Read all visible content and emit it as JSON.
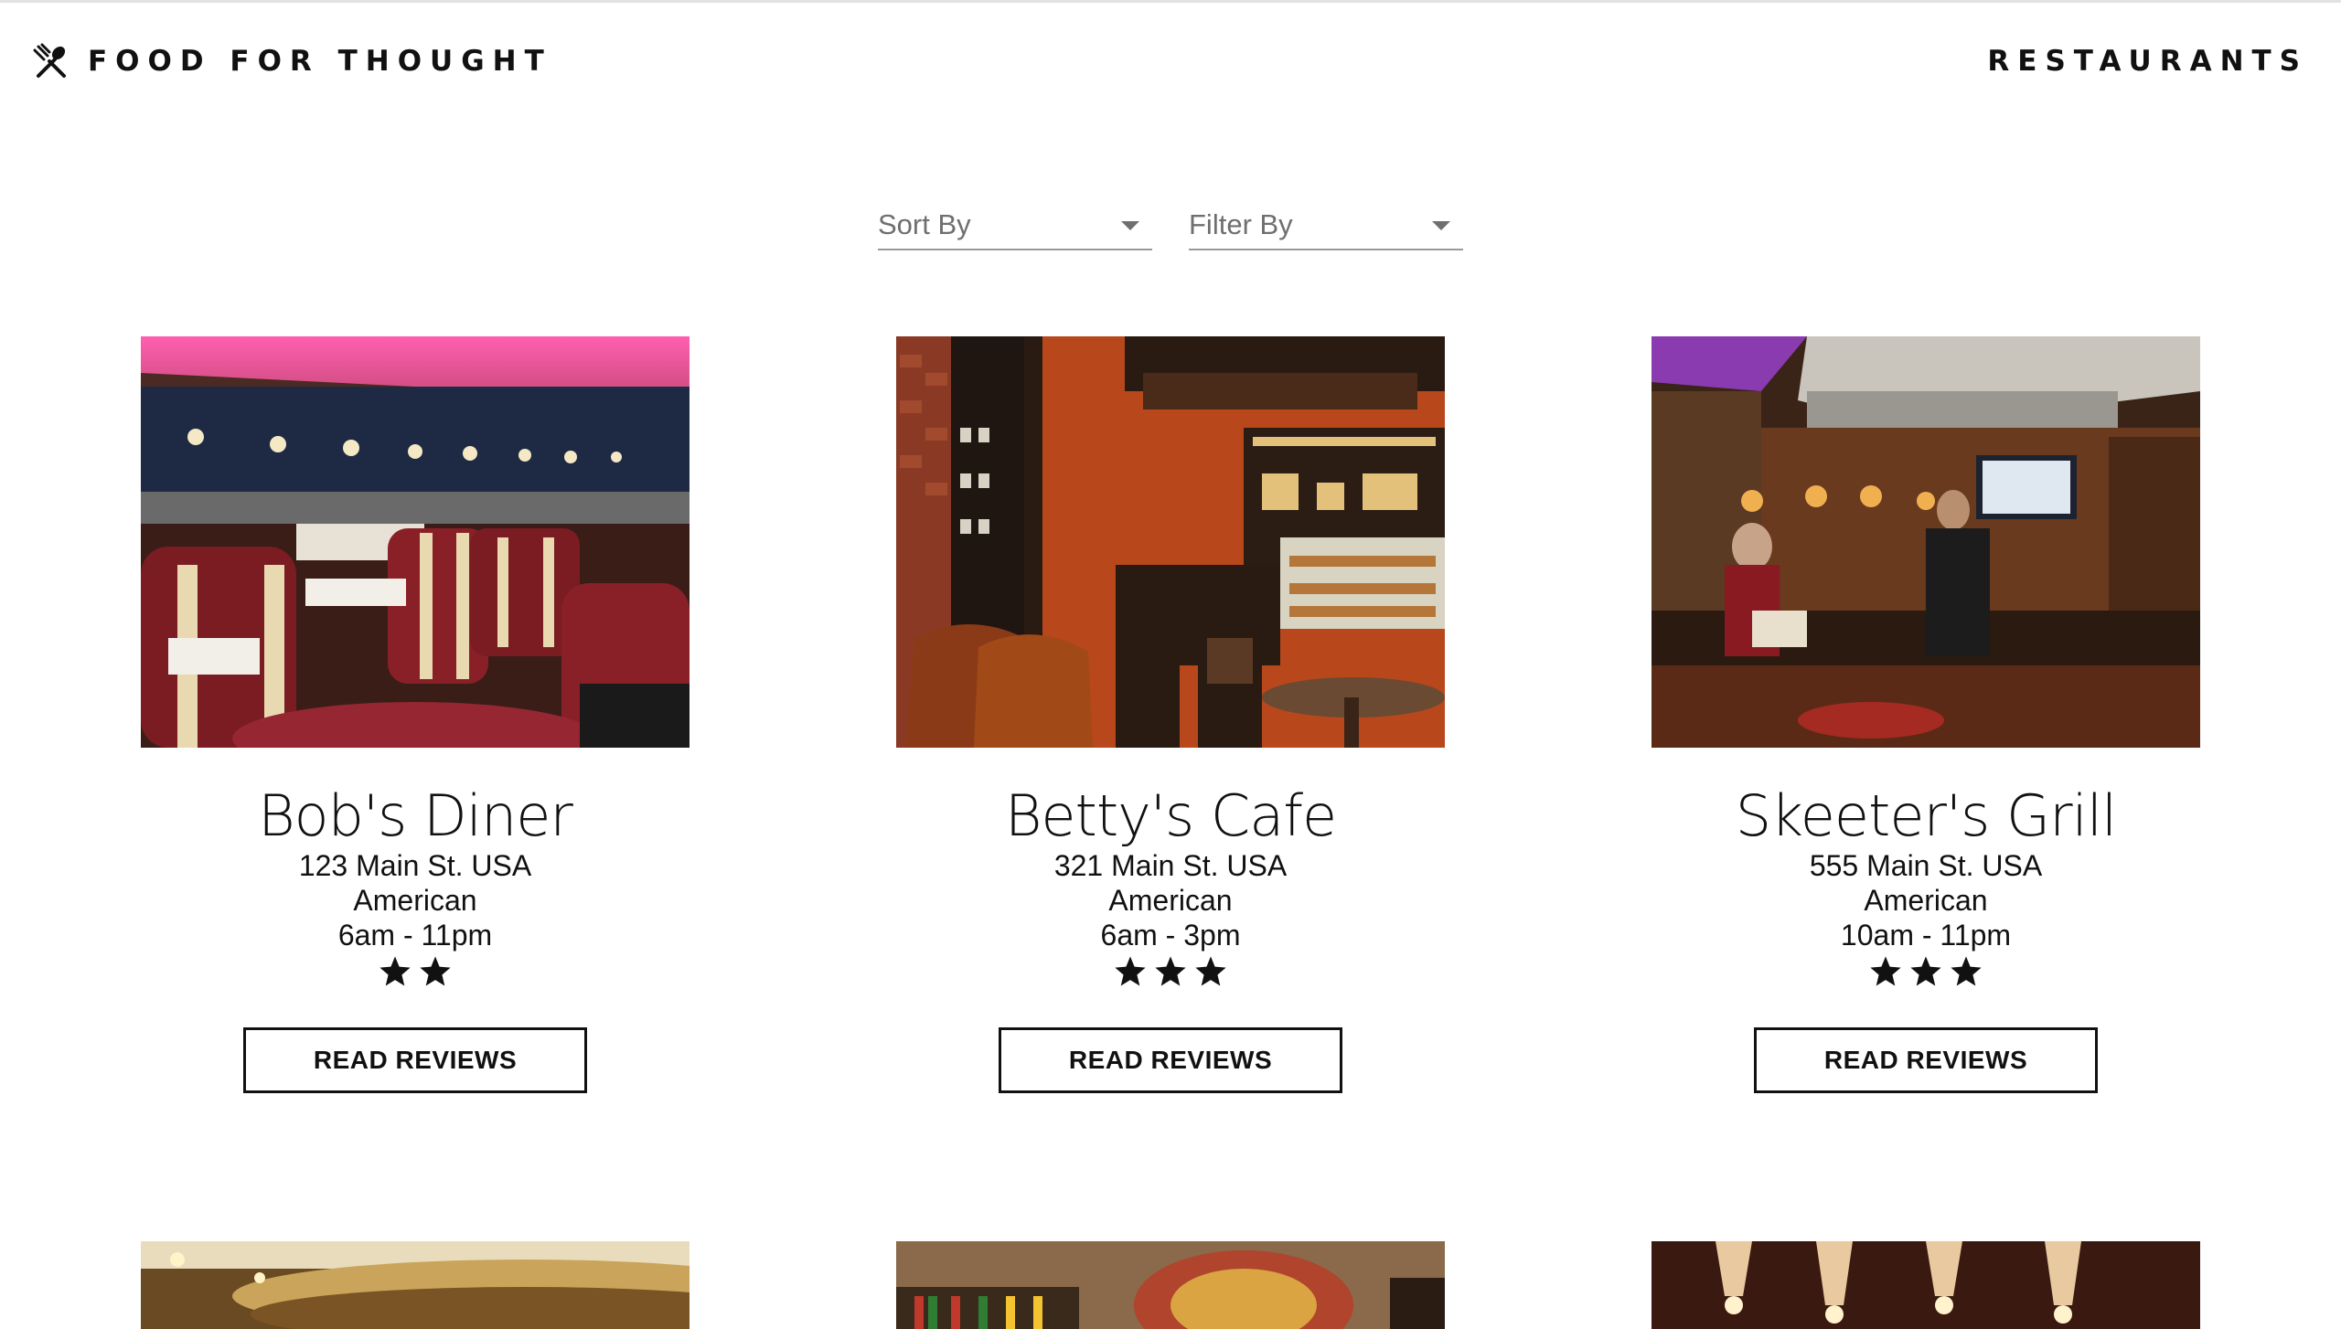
{
  "header": {
    "brand_title": "FOOD FOR THOUGHT",
    "brand_icon": "fork-and-spoon-icon",
    "nav_link": "RESTAURANTS"
  },
  "controls": {
    "sort_label": "Sort By",
    "filter_label": "Filter By"
  },
  "restaurants": [
    {
      "name": "Bob's Diner",
      "address": "123 Main St. USA",
      "cuisine": "American",
      "hours": "6am - 11pm",
      "rating": 2,
      "button_label": "READ REVIEWS"
    },
    {
      "name": "Betty's Cafe",
      "address": "321 Main St. USA",
      "cuisine": "American",
      "hours": "6am - 3pm",
      "rating": 3,
      "button_label": "READ REVIEWS"
    },
    {
      "name": "Skeeter's Grill",
      "address": "555 Main St. USA",
      "cuisine": "American",
      "hours": "10am - 11pm",
      "rating": 3,
      "button_label": "READ REVIEWS"
    }
  ],
  "colors": {
    "text": "#111111",
    "muted": "#6f6f6f",
    "underline": "#9a9a9a"
  }
}
